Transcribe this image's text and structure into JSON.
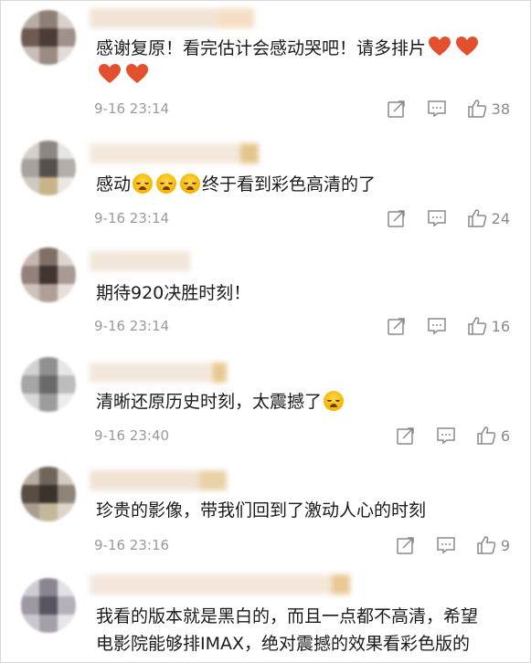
{
  "comments": [
    {
      "text_before": "感谢复原！看完估计会感动哭吧！请多排片",
      "text_after": "",
      "line2_extra": "",
      "time": "9-16 23:14",
      "likes": "38",
      "emoji": "heart",
      "emoji_count": 4
    },
    {
      "text_before": "感动",
      "text_after": "终于看到彩色高清的了",
      "time": "9-16 23:14",
      "likes": "24",
      "emoji": "crying-face",
      "emoji_count": 3
    },
    {
      "text_before": "期待920决胜时刻！",
      "text_after": "",
      "time": "9-16 23:14",
      "likes": "16"
    },
    {
      "text_before": "清晰还原历史时刻，太震撼了",
      "text_after": "",
      "time": "9-16 23:40",
      "likes": "6",
      "emoji": "crying-face",
      "emoji_count": 1
    },
    {
      "text_before": "珍贵的影像，带我们回到了激动人心的时刻",
      "text_after": "",
      "time": "9-16 23:16",
      "likes": "9"
    },
    {
      "text_line1": "我看的版本就是黑白的，而且一点都不高清，希望",
      "text_line2": "电影院能够排IMAX，绝对震撼的效果看彩色版的"
    }
  ],
  "icons": {
    "share": "share-icon",
    "comment": "comment-icon",
    "like": "thumbs-up-icon"
  },
  "colors": {
    "heart": "#e2502f",
    "meta": "#9a9a9a",
    "text": "#1a1a1a"
  }
}
